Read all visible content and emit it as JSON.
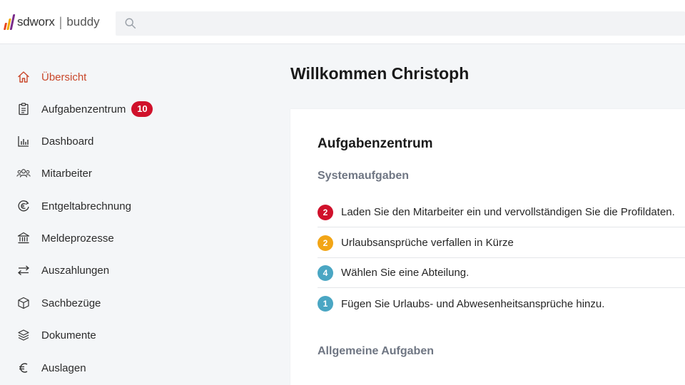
{
  "brand": {
    "name": "sdworx",
    "separator": "|",
    "product": "buddy",
    "colors": [
      "#e8451e",
      "#f2a900",
      "#7a2c8a",
      "#d0112b"
    ]
  },
  "search": {
    "placeholder": "",
    "value": ""
  },
  "sidebar": {
    "items": [
      {
        "label": "Übersicht",
        "icon": "home-icon",
        "active": true
      },
      {
        "label": "Aufgabenzentrum",
        "icon": "clipboard-icon",
        "badge": "10"
      },
      {
        "label": "Dashboard",
        "icon": "bar-chart-icon"
      },
      {
        "label": "Mitarbeiter",
        "icon": "users-icon"
      },
      {
        "label": "Entgeltabrechnung",
        "icon": "euro-cycle-icon"
      },
      {
        "label": "Meldeprozesse",
        "icon": "bank-icon"
      },
      {
        "label": "Auszahlungen",
        "icon": "transfer-arrows-icon"
      },
      {
        "label": "Sachbezüge",
        "icon": "box-icon"
      },
      {
        "label": "Dokumente",
        "icon": "layers-icon"
      },
      {
        "label": "Auslagen",
        "icon": "euro-icon"
      }
    ]
  },
  "main": {
    "welcome": "Willkommen Christoph",
    "card": {
      "title": "Aufgabenzentrum",
      "system_title": "Systemaufgaben",
      "tasks": [
        {
          "count": "2",
          "color": "#d0112b",
          "text": "Laden Sie den Mitarbeiter ein und vervollständigen Sie die Profildaten."
        },
        {
          "count": "2",
          "color": "#f2a516",
          "text": "Urlaubsansprüche verfallen in Kürze"
        },
        {
          "count": "4",
          "color": "#4aa6c3",
          "text": "Wählen Sie eine Abteilung."
        },
        {
          "count": "1",
          "color": "#4aa6c3",
          "text": "Fügen Sie Urlaubs- und Abwesenheitsansprüche hinzu."
        }
      ],
      "general_title": "Allgemeine Aufgaben"
    }
  },
  "colors": {
    "accent": "#c9472a",
    "badge": "#d0112b",
    "section_text": "#6f7683"
  }
}
